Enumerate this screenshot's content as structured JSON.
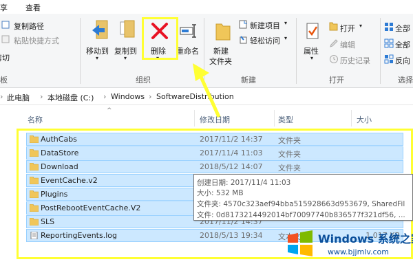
{
  "menubar": {
    "share_tab": "享",
    "view_tab": "查看"
  },
  "ribbon": {
    "copy_path": "复制路径",
    "paste_shortcut": "粘贴快捷方式",
    "cut": "剪切",
    "move_to": "移动到",
    "copy_to": "复制到",
    "delete": "删除",
    "rename": "重命名",
    "new_folder": "新建\n文件夹",
    "new_folder_line1": "新建",
    "new_folder_line2": "文件夹",
    "new_item": "新建项目",
    "easy_access": "轻松访问",
    "properties": "属性",
    "open": "打开",
    "edit": "编辑",
    "history": "历史记录",
    "select_all": "全部",
    "select_none": "全部",
    "invert": "反向",
    "group_clipboard_tail": "板",
    "group_organize": "组织",
    "group_new": "新建",
    "group_open": "打开",
    "group_select": "选择"
  },
  "address": {
    "crumbs": [
      "此电脑",
      "本地磁盘 (C:)",
      "Windows",
      "SoftwareDistribution"
    ]
  },
  "columns": {
    "name": "名称",
    "date": "修改日期",
    "type": "类型",
    "size": "大小"
  },
  "rows": [
    {
      "name": "AuthCabs",
      "date": "2017/11/2 14:37",
      "type": "文件夹",
      "size": ""
    },
    {
      "name": "DataStore",
      "date": "2017/11/4 11:03",
      "type": "文件夹",
      "size": ""
    },
    {
      "name": "Download",
      "date": "2018/5/12 14:07",
      "type": "文件夹",
      "size": ""
    },
    {
      "name": "EventCache.v2",
      "date": "",
      "type": "",
      "size": ""
    },
    {
      "name": "Plugins",
      "date": "",
      "type": "",
      "size": ""
    },
    {
      "name": "PostRebootEventCache.V2",
      "date": "",
      "type": "",
      "size": ""
    },
    {
      "name": "SLS",
      "date": "2017/11/2 14:37",
      "type": "",
      "size": ""
    },
    {
      "name": "ReportingEvents.log",
      "date": "2018/5/13 19:34",
      "type": "文本文档",
      "size": "1,017 KB"
    }
  ],
  "tooltip": {
    "created": "创建日期: 2017/11/4 11:03",
    "size": "大小: 532 MB",
    "folders": "文件夹: 4570c323aef94bba515928663d953679, SharedFil",
    "files": "文件: 0d8173214492014bf70097740b836577f321df56, ..."
  },
  "watermark": {
    "title": "Windows 系统之家",
    "url": "www.bjjmlv.com"
  },
  "colors": {
    "selection": "#cce8ff",
    "highlight": "#ffff33",
    "delete_red": "#e81123"
  }
}
